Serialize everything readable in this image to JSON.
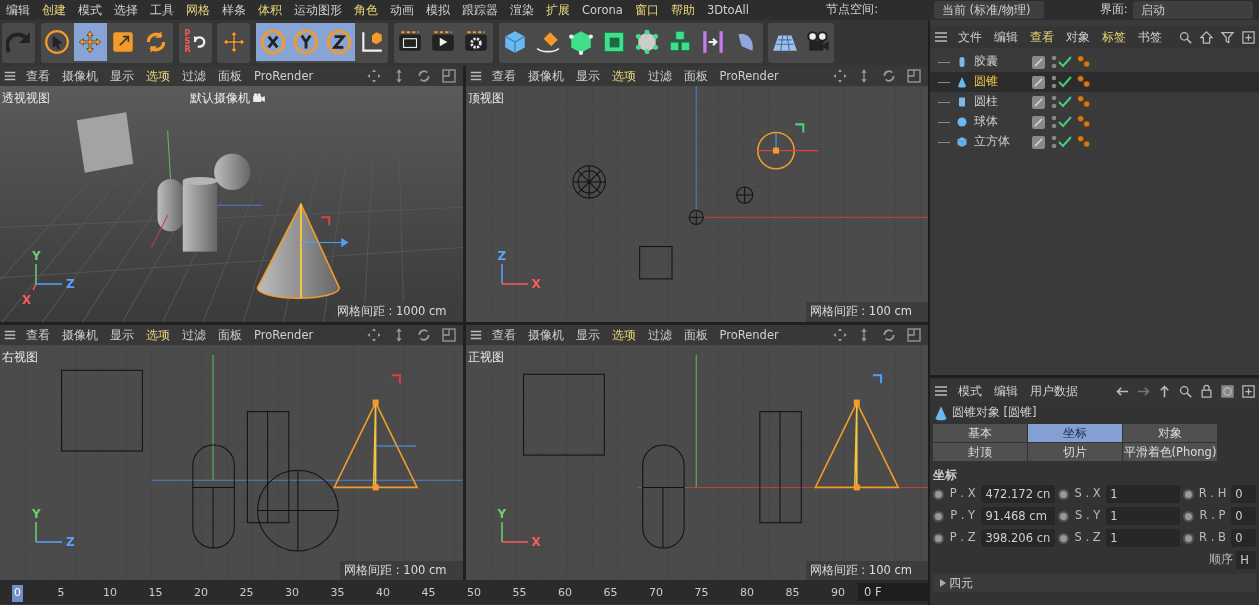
{
  "menu": [
    {
      "label": "编辑",
      "highlighted": false
    },
    {
      "label": "创建",
      "highlighted": true
    },
    {
      "label": "模式",
      "highlighted": false
    },
    {
      "label": "选择",
      "highlighted": false
    },
    {
      "label": "工具",
      "highlighted": false
    },
    {
      "label": "网格",
      "highlighted": true
    },
    {
      "label": "样条",
      "highlighted": false
    },
    {
      "label": "体积",
      "highlighted": true
    },
    {
      "label": "运动图形",
      "highlighted": false
    },
    {
      "label": "角色",
      "highlighted": true
    },
    {
      "label": "动画",
      "highlighted": false
    },
    {
      "label": "模拟",
      "highlighted": false
    },
    {
      "label": "跟踪器",
      "highlighted": false
    },
    {
      "label": "渲染",
      "highlighted": false
    },
    {
      "label": "扩展",
      "highlighted": true
    },
    {
      "label": "Corona",
      "highlighted": false
    },
    {
      "label": "窗口",
      "highlighted": true
    },
    {
      "label": "帮助",
      "highlighted": true
    },
    {
      "label": "3DtoAll",
      "highlighted": false
    }
  ],
  "node_space": {
    "label": "节点空间:",
    "value": "当前 (标准/物理)"
  },
  "layout": {
    "label": "界面:",
    "value": "启动"
  },
  "toolbar": [
    [
      {
        "kind": "undo",
        "selected": false
      }
    ],
    [
      {
        "kind": "select",
        "selected": false
      },
      {
        "kind": "move",
        "selected": true
      },
      {
        "kind": "scale",
        "selected": false
      },
      {
        "kind": "rotate",
        "selected": false
      }
    ],
    [
      {
        "kind": "psr",
        "selected": false,
        "letters": [
          "P",
          "S",
          "R"
        ]
      }
    ],
    [
      {
        "kind": "move",
        "selected": false
      }
    ],
    [
      {
        "kind": "x",
        "selected": true
      },
      {
        "kind": "y",
        "selected": true
      },
      {
        "kind": "z",
        "selected": true
      },
      {
        "kind": "coords",
        "selected": false
      }
    ],
    [
      {
        "kind": "render-frame",
        "selected": false
      },
      {
        "kind": "render-play",
        "selected": false
      },
      {
        "kind": "render-gear",
        "selected": false
      }
    ],
    [
      {
        "kind": "cube",
        "selected": false
      },
      {
        "kind": "pen",
        "selected": false
      },
      {
        "kind": "green-cube",
        "selected": false
      },
      {
        "kind": "green-box",
        "selected": false
      },
      {
        "kind": "nodes-cube",
        "selected": false
      },
      {
        "kind": "cubes",
        "selected": false
      },
      {
        "kind": "bracket-arrow",
        "selected": false
      },
      {
        "kind": "bend",
        "selected": false
      }
    ],
    [
      {
        "kind": "floor",
        "selected": false
      },
      {
        "kind": "camera",
        "selected": false
      }
    ]
  ],
  "viewports": [
    {
      "kind": "perspective",
      "menu": [
        {
          "label": "查看",
          "highlighted": false
        },
        {
          "label": "摄像机",
          "highlighted": false
        },
        {
          "label": "显示",
          "highlighted": false
        },
        {
          "label": "选项",
          "highlighted": true
        },
        {
          "label": "过滤",
          "highlighted": false
        },
        {
          "label": "面板",
          "highlighted": false
        },
        {
          "label": "ProRender",
          "highlighted": false
        }
      ],
      "title": "透视视图",
      "camera": "默认摄像机",
      "grid": "网格间距 : 1000 cm",
      "axis_labels": [
        {
          "text": "Y",
          "color": "#6fcf6f"
        },
        {
          "text": "Z",
          "color": "#5aa0ff"
        },
        {
          "text": "X",
          "color": "#ff5a5a"
        }
      ]
    },
    {
      "kind": "top",
      "menu": [
        {
          "label": "查看",
          "highlighted": false
        },
        {
          "label": "摄像机",
          "highlighted": false
        },
        {
          "label": "显示",
          "highlighted": false
        },
        {
          "label": "选项",
          "highlighted": true
        },
        {
          "label": "过滤",
          "highlighted": false
        },
        {
          "label": "面板",
          "highlighted": false
        },
        {
          "label": "ProRender",
          "highlighted": false
        }
      ],
      "title": "顶视图",
      "grid": "网格间距 : 100 cm",
      "axis_labels": [
        {
          "text": "Z",
          "color": "#5aa0ff"
        },
        {
          "text": "X",
          "color": "#ff5a5a"
        }
      ]
    },
    {
      "kind": "right",
      "menu": [
        {
          "label": "查看",
          "highlighted": false
        },
        {
          "label": "摄像机",
          "highlighted": false
        },
        {
          "label": "显示",
          "highlighted": false
        },
        {
          "label": "选项",
          "highlighted": true
        },
        {
          "label": "过滤",
          "highlighted": false
        },
        {
          "label": "面板",
          "highlighted": false
        },
        {
          "label": "ProRender",
          "highlighted": false
        }
      ],
      "title": "右视图",
      "grid": "网格间距 : 100 cm",
      "axis_labels": [
        {
          "text": "Y",
          "color": "#6fcf6f"
        },
        {
          "text": "Z",
          "color": "#5aa0ff"
        }
      ]
    },
    {
      "kind": "front",
      "menu": [
        {
          "label": "查看",
          "highlighted": false
        },
        {
          "label": "摄像机",
          "highlighted": false
        },
        {
          "label": "显示",
          "highlighted": false
        },
        {
          "label": "选项",
          "highlighted": true
        },
        {
          "label": "过滤",
          "highlighted": false
        },
        {
          "label": "面板",
          "highlighted": false
        },
        {
          "label": "ProRender",
          "highlighted": false
        }
      ],
      "title": "正视图",
      "grid": "网格间距 : 100 cm",
      "axis_labels": [
        {
          "text": "Y",
          "color": "#6fcf6f"
        },
        {
          "text": "X",
          "color": "#ff5a5a"
        }
      ]
    }
  ],
  "timeline": {
    "ticks": [
      {
        "label": "0",
        "selected": true
      },
      {
        "label": "5",
        "selected": false
      },
      {
        "label": "10",
        "selected": false
      },
      {
        "label": "15",
        "selected": false
      },
      {
        "label": "20",
        "selected": false
      },
      {
        "label": "25",
        "selected": false
      },
      {
        "label": "30",
        "selected": false
      },
      {
        "label": "35",
        "selected": false
      },
      {
        "label": "40",
        "selected": false
      },
      {
        "label": "45",
        "selected": false
      },
      {
        "label": "50",
        "selected": false
      },
      {
        "label": "55",
        "selected": false
      },
      {
        "label": "60",
        "selected": false
      },
      {
        "label": "65",
        "selected": false
      },
      {
        "label": "70",
        "selected": false
      },
      {
        "label": "75",
        "selected": false
      },
      {
        "label": "80",
        "selected": false
      },
      {
        "label": "85",
        "selected": false
      },
      {
        "label": "90",
        "selected": false
      }
    ],
    "frame": "0 F"
  },
  "object_manager": {
    "menu": [
      {
        "label": "文件",
        "highlighted": false
      },
      {
        "label": "编辑",
        "highlighted": false
      },
      {
        "label": "查看",
        "highlighted": true
      },
      {
        "label": "对象",
        "highlighted": false
      },
      {
        "label": "标签",
        "highlighted": true
      },
      {
        "label": "书签",
        "highlighted": false
      }
    ],
    "objects": [
      {
        "kind": "capsule",
        "name": "胶囊",
        "selected": false,
        "enabled": true
      },
      {
        "kind": "cone",
        "name": "圆锥",
        "selected": true,
        "enabled": true
      },
      {
        "kind": "cylinder",
        "name": "圆柱",
        "selected": false,
        "enabled": true
      },
      {
        "kind": "sphere",
        "name": "球体",
        "selected": false,
        "enabled": true
      },
      {
        "kind": "cube",
        "name": "立方体",
        "selected": false,
        "enabled": true
      }
    ]
  },
  "attributes": {
    "menu": [
      "模式",
      "编辑",
      "用户数据"
    ],
    "title": "圆锥对象 [圆锥]",
    "tabs": [
      {
        "label": "基本",
        "selected": false
      },
      {
        "label": "坐标",
        "selected": true
      },
      {
        "label": "对象",
        "selected": false
      },
      {
        "label": "封顶",
        "selected": false
      },
      {
        "label": "切片",
        "selected": false
      },
      {
        "label": "平滑着色(Phong)",
        "selected": false
      }
    ],
    "section": "坐标",
    "rows": [
      [
        {
          "label": "P . X",
          "value": "472.172 cn",
          "keyed": false
        },
        {
          "label": "S . X",
          "value": "1",
          "keyed": false
        },
        {
          "label": "R . H",
          "value": "0",
          "keyed": false
        }
      ],
      [
        {
          "label": "P . Y",
          "value": "91.468 cm",
          "keyed": false
        },
        {
          "label": "S . Y",
          "value": "1",
          "keyed": false
        },
        {
          "label": "R . P",
          "value": "0",
          "keyed": false
        }
      ],
      [
        {
          "label": "P . Z",
          "value": "398.206 cn",
          "keyed": false
        },
        {
          "label": "S . Z",
          "value": "1",
          "keyed": false
        },
        {
          "label": "R . B",
          "value": "0",
          "keyed": false
        }
      ]
    ],
    "order": {
      "label": "顺序",
      "value": "H"
    },
    "group": {
      "label": "四元",
      "expanded": false
    }
  }
}
